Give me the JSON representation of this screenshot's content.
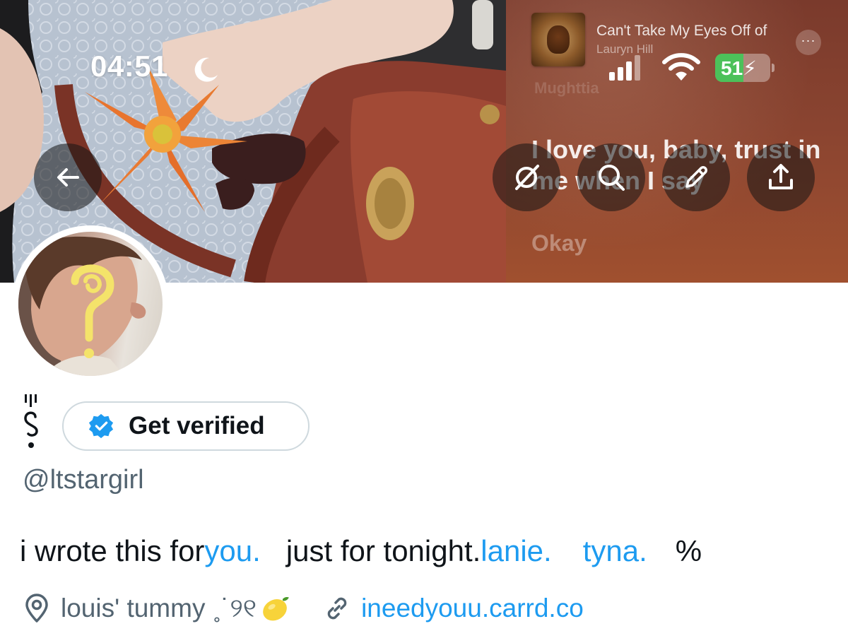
{
  "status_bar": {
    "time": "04:51",
    "battery": "51",
    "battery_level": 0.51,
    "icons": [
      "moon-icon",
      "signal-icon",
      "wifi-icon",
      "battery-icon"
    ]
  },
  "now_playing": {
    "title": "Can't Take My Eyes Off of",
    "artist": "Lauryn Hill",
    "lyric_previous": "Mughttia",
    "lyric_current": "I love you, baby, trust in me when I say",
    "lyric_next": "Okay",
    "more_label": "···"
  },
  "header_buttons": [
    "back-arrow-icon",
    "grok-icon",
    "search-icon",
    "edit-icon",
    "share-icon"
  ],
  "profile": {
    "verify_label": "Get verified",
    "handle": "@ltstargirl",
    "bio": {
      "t1": "i wrote this for ",
      "l1": "you.",
      "t2": "just for tonight. ",
      "l2": "lanie.",
      "l3": "tyna.",
      "t3": "%"
    },
    "location": "louis' tummy ˳˙୨୧",
    "website": "ineedyouu.carrd.co"
  },
  "colors": {
    "link": "#1d9bf0",
    "secondary_text": "#536471",
    "verified": "#1d9bf0",
    "battery_green": "#4cc15a"
  }
}
